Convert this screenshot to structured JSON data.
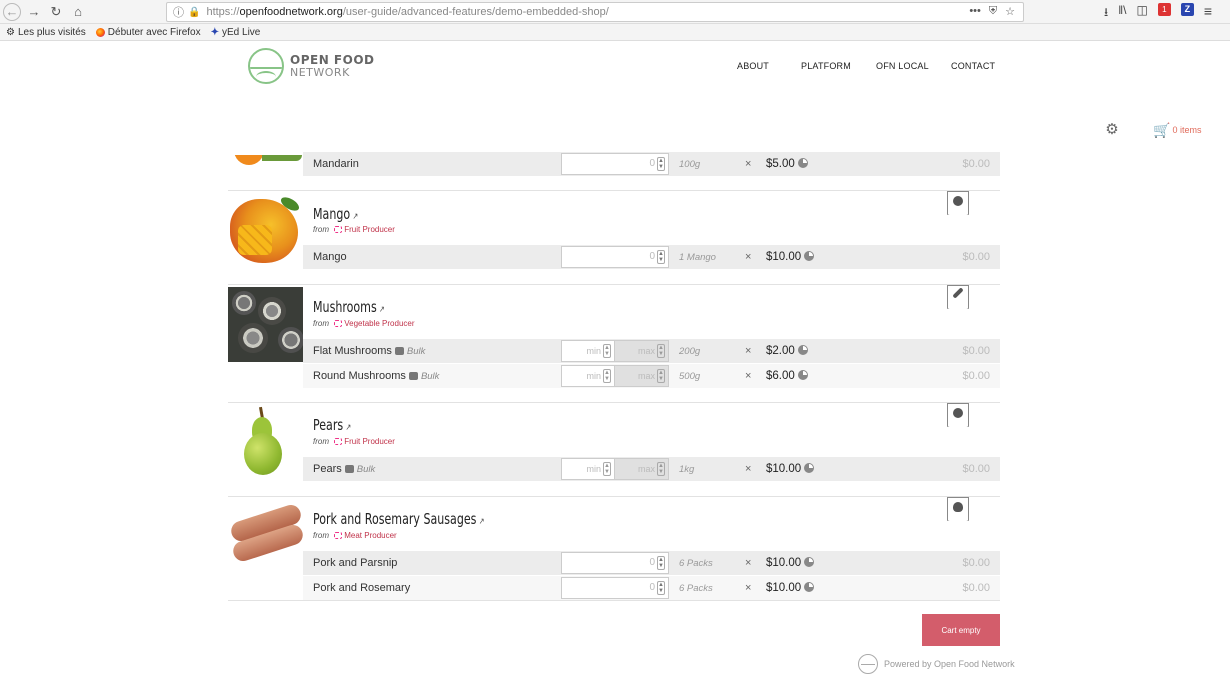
{
  "browser": {
    "url_protocol": "https://",
    "url_host": "openfoodnetwork.org",
    "url_path": "/user-guide/advanced-features/demo-embedded-shop/",
    "url_actions": "•••",
    "bookmarks": [
      {
        "label": "Les plus visités",
        "icon": "gear-icon"
      },
      {
        "label": "Débuter avec Firefox",
        "icon": "firefox-icon"
      },
      {
        "label": "yEd Live",
        "icon": "yed-icon"
      }
    ],
    "addon_red_count": "1",
    "addon_blue_letter": "Z"
  },
  "header": {
    "logo_line1": "OPEN FOOD",
    "logo_line2": "NETWORK",
    "nav": [
      "ABOUT",
      "PLATFORM",
      "OFN LOCAL",
      "CONTACT"
    ],
    "cart_label": "0 items"
  },
  "products": [
    {
      "name": "Mandarin",
      "variants": [
        {
          "name": "Mandarin",
          "qty_placeholder": "0",
          "unit": "100g",
          "price": "$5.00",
          "total": "$0.00",
          "bulk": false
        }
      ]
    },
    {
      "name": "Mango",
      "from": "from",
      "producer": "Fruit Producer",
      "icon": "apple-icon",
      "variants": [
        {
          "name": "Mango",
          "qty_placeholder": "0",
          "unit": "1 Mango",
          "price": "$10.00",
          "total": "$0.00",
          "bulk": false
        }
      ]
    },
    {
      "name": "Mushrooms",
      "from": "from",
      "producer": "Vegetable Producer",
      "icon": "carrot-icon",
      "variants": [
        {
          "name": "Flat Mushrooms",
          "bulk_label": "Bulk",
          "min_placeholder": "min",
          "max_placeholder": "max",
          "unit": "200g",
          "price": "$2.00",
          "total": "$0.00",
          "bulk": true
        },
        {
          "name": "Round Mushrooms",
          "bulk_label": "Bulk",
          "min_placeholder": "min",
          "max_placeholder": "max",
          "unit": "500g",
          "price": "$6.00",
          "total": "$0.00",
          "bulk": true
        }
      ]
    },
    {
      "name": "Pears",
      "from": "from",
      "producer": "Fruit Producer",
      "icon": "apple-icon",
      "variants": [
        {
          "name": "Pears",
          "bulk_label": "Bulk",
          "min_placeholder": "min",
          "max_placeholder": "max",
          "unit": "1kg",
          "price": "$10.00",
          "total": "$0.00",
          "bulk": true
        }
      ]
    },
    {
      "name": "Pork and Rosemary Sausages",
      "from": "from",
      "producer": "Meat Producer",
      "icon": "meat-icon",
      "variants": [
        {
          "name": "Pork and Parsnip",
          "qty_placeholder": "0",
          "unit": "6 Packs",
          "price": "$10.00",
          "total": "$0.00",
          "bulk": false
        },
        {
          "name": "Pork and Rosemary",
          "qty_placeholder": "0",
          "unit": "6 Packs",
          "price": "$10.00",
          "total": "$0.00",
          "bulk": false
        }
      ]
    }
  ],
  "times_symbol": "×",
  "cart_button": "Cart empty",
  "powered_by": "Powered by Open Food Network",
  "colors": {
    "accent": "#d35d6b",
    "cart": "#e06b5b",
    "producer": "#c0334a",
    "logo": "#88c487"
  }
}
